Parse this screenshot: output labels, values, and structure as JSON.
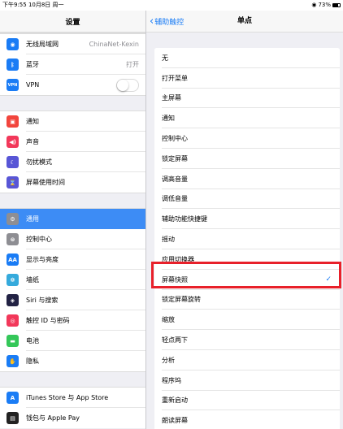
{
  "status_bar": {
    "time": "下午9:55  10月8日 周一",
    "battery": "73%"
  },
  "left_panel": {
    "title": "设置",
    "groups": [
      [
        {
          "label": "无线局域网",
          "value": "ChinaNet-Kexin",
          "icon": "wifi-icon",
          "color": "#1a7cf5",
          "glyph": "◉"
        },
        {
          "label": "蓝牙",
          "value": "打开",
          "icon": "bluetooth-icon",
          "color": "#1a7cf5",
          "glyph": "ᛒ"
        },
        {
          "label": "VPN",
          "toggle": false,
          "icon": "vpn-icon",
          "color": "#1a7cf5",
          "glyph": "VPN"
        }
      ],
      [
        {
          "label": "通知",
          "icon": "notifications-icon",
          "color": "#f2453d",
          "glyph": "▣"
        },
        {
          "label": "声音",
          "icon": "sound-icon",
          "color": "#f2385a",
          "glyph": "◀)"
        },
        {
          "label": "勿扰模式",
          "icon": "do-not-disturb-icon",
          "color": "#5856d6",
          "glyph": "☾"
        },
        {
          "label": "屏幕使用时间",
          "icon": "screen-time-icon",
          "color": "#5856d6",
          "glyph": "⌛"
        }
      ],
      [
        {
          "label": "通用",
          "icon": "general-icon",
          "color": "#8e8e93",
          "glyph": "⚙",
          "selected": true
        },
        {
          "label": "控制中心",
          "icon": "control-center-icon",
          "color": "#8e8e93",
          "glyph": "⊜"
        },
        {
          "label": "显示与亮度",
          "icon": "display-icon",
          "color": "#1a7cf5",
          "glyph": "AA"
        },
        {
          "label": "墙纸",
          "icon": "wallpaper-icon",
          "color": "#35aadc",
          "glyph": "❁"
        },
        {
          "label": "Siri 与搜索",
          "icon": "siri-icon",
          "color": "#222244",
          "glyph": "◈"
        },
        {
          "label": "触控 ID 与密码",
          "icon": "touch-id-icon",
          "color": "#f2385a",
          "glyph": "◎"
        },
        {
          "label": "电池",
          "icon": "battery-icon",
          "color": "#34c759",
          "glyph": "▬"
        },
        {
          "label": "隐私",
          "icon": "privacy-icon",
          "color": "#1a7cf5",
          "glyph": "✋"
        }
      ],
      [
        {
          "label": "iTunes Store 与 App Store",
          "icon": "app-store-icon",
          "color": "#1a7cf5",
          "glyph": "A"
        },
        {
          "label": "钱包与 Apple Pay",
          "icon": "wallet-icon",
          "color": "#222222",
          "glyph": "▤"
        }
      ]
    ]
  },
  "right_panel": {
    "back_label": "辅助触控",
    "title": "单点",
    "items": [
      {
        "label": "无"
      },
      {
        "label": "打开菜单"
      },
      {
        "label": "主屏幕"
      },
      {
        "label": "通知"
      },
      {
        "label": "控制中心"
      },
      {
        "label": "锁定屏幕"
      },
      {
        "label": "调高音量"
      },
      {
        "label": "调低音量"
      },
      {
        "label": "辅助功能快捷键"
      },
      {
        "label": "摇动"
      },
      {
        "label": "应用切换器"
      },
      {
        "label": "屏幕快照",
        "checked": true
      },
      {
        "label": "锁定屏幕旋转"
      },
      {
        "label": "缩放"
      },
      {
        "label": "轻点两下"
      },
      {
        "label": "分析"
      },
      {
        "label": "程序坞"
      },
      {
        "label": "重新启动"
      },
      {
        "label": "朗读屏幕"
      }
    ]
  },
  "colors": {
    "accent": "#1a7cf5",
    "selected_row": "#3d8cf5",
    "highlight_border": "#e8202a"
  }
}
